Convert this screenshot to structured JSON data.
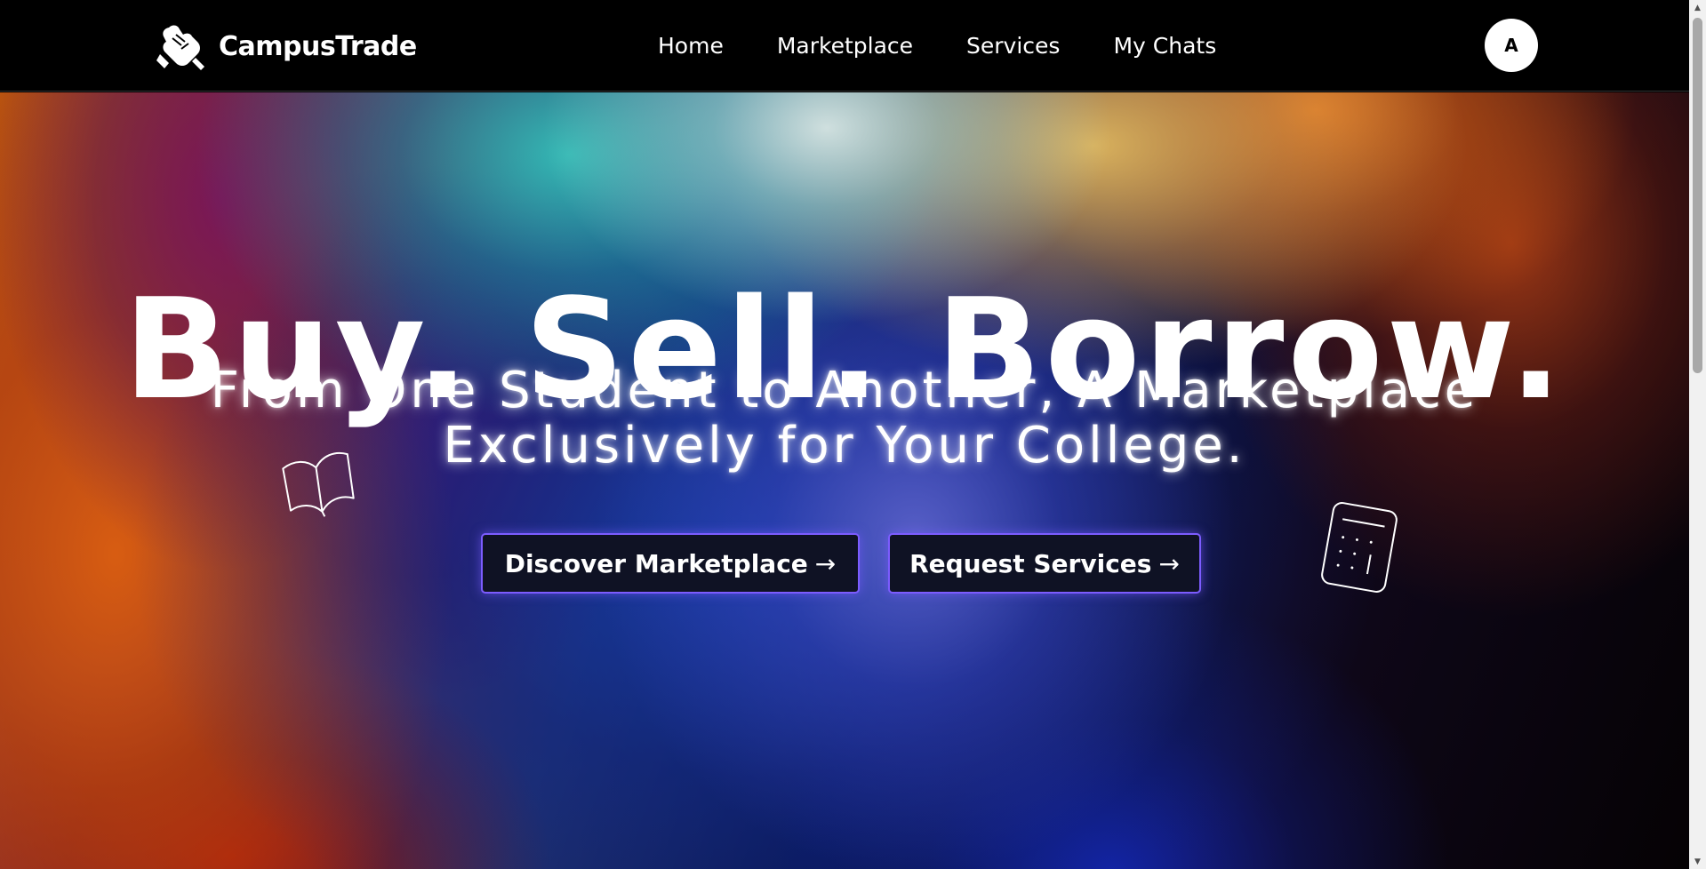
{
  "brand": {
    "name": "CampusTrade"
  },
  "nav": {
    "items": [
      {
        "label": "Home"
      },
      {
        "label": "Marketplace"
      },
      {
        "label": "Services"
      },
      {
        "label": "My Chats"
      }
    ],
    "avatar_initial": "A"
  },
  "hero": {
    "title": "Buy. Sell. Borrow.",
    "subtitle_line1": "From One Student to Another, A Marketplace",
    "subtitle_line2": "Exclusively for Your College.",
    "cta_primary": "Discover Marketplace",
    "cta_secondary": "Request Services",
    "arrow": "→"
  },
  "icons": {
    "logo": "handshake-icon",
    "book": "book-icon",
    "calculator": "calculator-icon"
  },
  "colors": {
    "nav_bg": "#000000",
    "button_bg": "#0f1224",
    "button_border": "#7c5cff",
    "text": "#ffffff"
  }
}
